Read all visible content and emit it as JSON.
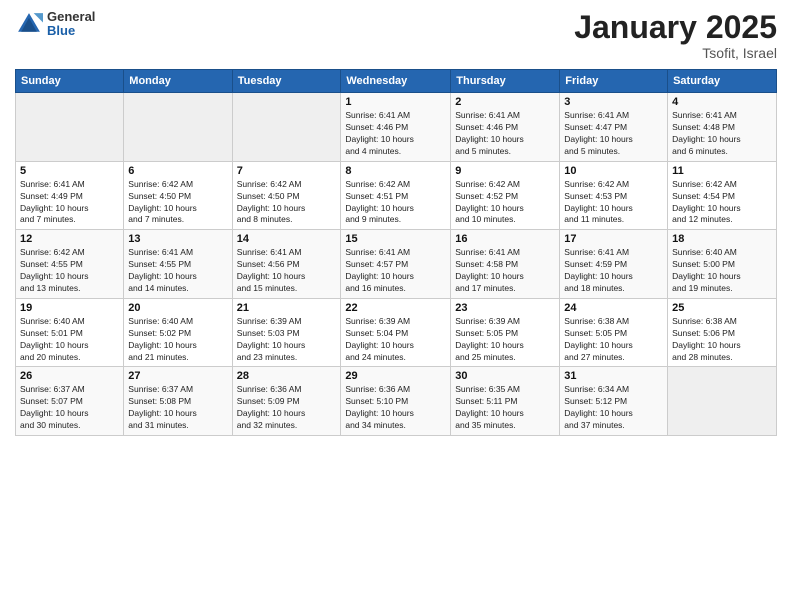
{
  "header": {
    "logo_general": "General",
    "logo_blue": "Blue",
    "title": "January 2025",
    "subtitle": "Tsofit, Israel"
  },
  "days_of_week": [
    "Sunday",
    "Monday",
    "Tuesday",
    "Wednesday",
    "Thursday",
    "Friday",
    "Saturday"
  ],
  "weeks": [
    [
      {
        "day": "",
        "info": ""
      },
      {
        "day": "",
        "info": ""
      },
      {
        "day": "",
        "info": ""
      },
      {
        "day": "1",
        "info": "Sunrise: 6:41 AM\nSunset: 4:46 PM\nDaylight: 10 hours\nand 4 minutes."
      },
      {
        "day": "2",
        "info": "Sunrise: 6:41 AM\nSunset: 4:46 PM\nDaylight: 10 hours\nand 5 minutes."
      },
      {
        "day": "3",
        "info": "Sunrise: 6:41 AM\nSunset: 4:47 PM\nDaylight: 10 hours\nand 5 minutes."
      },
      {
        "day": "4",
        "info": "Sunrise: 6:41 AM\nSunset: 4:48 PM\nDaylight: 10 hours\nand 6 minutes."
      }
    ],
    [
      {
        "day": "5",
        "info": "Sunrise: 6:41 AM\nSunset: 4:49 PM\nDaylight: 10 hours\nand 7 minutes."
      },
      {
        "day": "6",
        "info": "Sunrise: 6:42 AM\nSunset: 4:50 PM\nDaylight: 10 hours\nand 7 minutes."
      },
      {
        "day": "7",
        "info": "Sunrise: 6:42 AM\nSunset: 4:50 PM\nDaylight: 10 hours\nand 8 minutes."
      },
      {
        "day": "8",
        "info": "Sunrise: 6:42 AM\nSunset: 4:51 PM\nDaylight: 10 hours\nand 9 minutes."
      },
      {
        "day": "9",
        "info": "Sunrise: 6:42 AM\nSunset: 4:52 PM\nDaylight: 10 hours\nand 10 minutes."
      },
      {
        "day": "10",
        "info": "Sunrise: 6:42 AM\nSunset: 4:53 PM\nDaylight: 10 hours\nand 11 minutes."
      },
      {
        "day": "11",
        "info": "Sunrise: 6:42 AM\nSunset: 4:54 PM\nDaylight: 10 hours\nand 12 minutes."
      }
    ],
    [
      {
        "day": "12",
        "info": "Sunrise: 6:42 AM\nSunset: 4:55 PM\nDaylight: 10 hours\nand 13 minutes."
      },
      {
        "day": "13",
        "info": "Sunrise: 6:41 AM\nSunset: 4:55 PM\nDaylight: 10 hours\nand 14 minutes."
      },
      {
        "day": "14",
        "info": "Sunrise: 6:41 AM\nSunset: 4:56 PM\nDaylight: 10 hours\nand 15 minutes."
      },
      {
        "day": "15",
        "info": "Sunrise: 6:41 AM\nSunset: 4:57 PM\nDaylight: 10 hours\nand 16 minutes."
      },
      {
        "day": "16",
        "info": "Sunrise: 6:41 AM\nSunset: 4:58 PM\nDaylight: 10 hours\nand 17 minutes."
      },
      {
        "day": "17",
        "info": "Sunrise: 6:41 AM\nSunset: 4:59 PM\nDaylight: 10 hours\nand 18 minutes."
      },
      {
        "day": "18",
        "info": "Sunrise: 6:40 AM\nSunset: 5:00 PM\nDaylight: 10 hours\nand 19 minutes."
      }
    ],
    [
      {
        "day": "19",
        "info": "Sunrise: 6:40 AM\nSunset: 5:01 PM\nDaylight: 10 hours\nand 20 minutes."
      },
      {
        "day": "20",
        "info": "Sunrise: 6:40 AM\nSunset: 5:02 PM\nDaylight: 10 hours\nand 21 minutes."
      },
      {
        "day": "21",
        "info": "Sunrise: 6:39 AM\nSunset: 5:03 PM\nDaylight: 10 hours\nand 23 minutes."
      },
      {
        "day": "22",
        "info": "Sunrise: 6:39 AM\nSunset: 5:04 PM\nDaylight: 10 hours\nand 24 minutes."
      },
      {
        "day": "23",
        "info": "Sunrise: 6:39 AM\nSunset: 5:05 PM\nDaylight: 10 hours\nand 25 minutes."
      },
      {
        "day": "24",
        "info": "Sunrise: 6:38 AM\nSunset: 5:05 PM\nDaylight: 10 hours\nand 27 minutes."
      },
      {
        "day": "25",
        "info": "Sunrise: 6:38 AM\nSunset: 5:06 PM\nDaylight: 10 hours\nand 28 minutes."
      }
    ],
    [
      {
        "day": "26",
        "info": "Sunrise: 6:37 AM\nSunset: 5:07 PM\nDaylight: 10 hours\nand 30 minutes."
      },
      {
        "day": "27",
        "info": "Sunrise: 6:37 AM\nSunset: 5:08 PM\nDaylight: 10 hours\nand 31 minutes."
      },
      {
        "day": "28",
        "info": "Sunrise: 6:36 AM\nSunset: 5:09 PM\nDaylight: 10 hours\nand 32 minutes."
      },
      {
        "day": "29",
        "info": "Sunrise: 6:36 AM\nSunset: 5:10 PM\nDaylight: 10 hours\nand 34 minutes."
      },
      {
        "day": "30",
        "info": "Sunrise: 6:35 AM\nSunset: 5:11 PM\nDaylight: 10 hours\nand 35 minutes."
      },
      {
        "day": "31",
        "info": "Sunrise: 6:34 AM\nSunset: 5:12 PM\nDaylight: 10 hours\nand 37 minutes."
      },
      {
        "day": "",
        "info": ""
      }
    ]
  ]
}
